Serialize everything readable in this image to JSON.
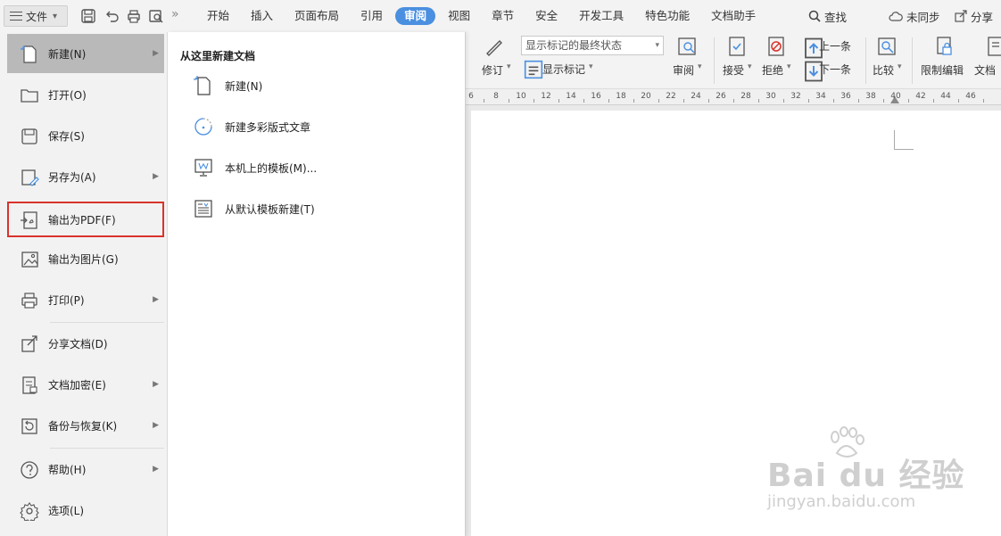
{
  "menubar": {
    "file_label": "文件",
    "tabs": [
      "开始",
      "插入",
      "页面布局",
      "引用",
      "审阅",
      "视图",
      "章节",
      "安全",
      "开发工具",
      "特色功能",
      "文档助手"
    ],
    "search_label": "查找",
    "sync_label": "未同步",
    "share_label": "分享"
  },
  "ribbon": {
    "revise_label": "修订",
    "display_state": "显示标记的最终状态",
    "show_marks_label": "显示标记",
    "review_label": "审阅",
    "accept_label": "接受",
    "reject_label": "拒绝",
    "prev_label": "上一条",
    "next_label": "下一条",
    "compare_label": "比较",
    "restrict_label": "限制编辑",
    "doc_label": "文档"
  },
  "ruler": {
    "ticks": [
      "6",
      "8",
      "10",
      "12",
      "14",
      "16",
      "18",
      "20",
      "22",
      "24",
      "26",
      "28",
      "30",
      "32",
      "34",
      "36",
      "38",
      "40",
      "42",
      "44",
      "46"
    ]
  },
  "file_menu": {
    "items": [
      {
        "label": "新建(N)",
        "icon": "new-doc-icon"
      },
      {
        "label": "打开(O)",
        "icon": "folder-icon"
      },
      {
        "label": "保存(S)",
        "icon": "save-icon"
      },
      {
        "label": "另存为(A)",
        "icon": "save-as-icon"
      },
      {
        "label": "输出为PDF(F)",
        "icon": "export-pdf-icon"
      },
      {
        "label": "输出为图片(G)",
        "icon": "export-image-icon"
      },
      {
        "label": "打印(P)",
        "icon": "printer-icon"
      },
      {
        "label": "分享文档(D)",
        "icon": "share-icon"
      },
      {
        "label": "文档加密(E)",
        "icon": "encrypt-icon"
      },
      {
        "label": "备份与恢复(K)",
        "icon": "backup-icon"
      },
      {
        "label": "帮助(H)",
        "icon": "help-icon"
      },
      {
        "label": "选项(L)",
        "icon": "settings-icon"
      }
    ]
  },
  "submenu": {
    "title": "从这里新建文档",
    "items": [
      {
        "label": "新建(N)",
        "icon": "blank-doc-icon"
      },
      {
        "label": "新建多彩版式文章",
        "icon": "colorful-article-icon"
      },
      {
        "label": "本机上的模板(M)...",
        "icon": "local-template-icon"
      },
      {
        "label": "从默认模板新建(T)",
        "icon": "default-template-icon"
      }
    ]
  },
  "watermark": {
    "brand": "Bai du 经验",
    "url": "jingyan.baidu.com"
  },
  "colors": {
    "active_tab": "#4a8fe0",
    "highlight_border": "#d9332c",
    "hover_bg": "#b9b9b9"
  }
}
